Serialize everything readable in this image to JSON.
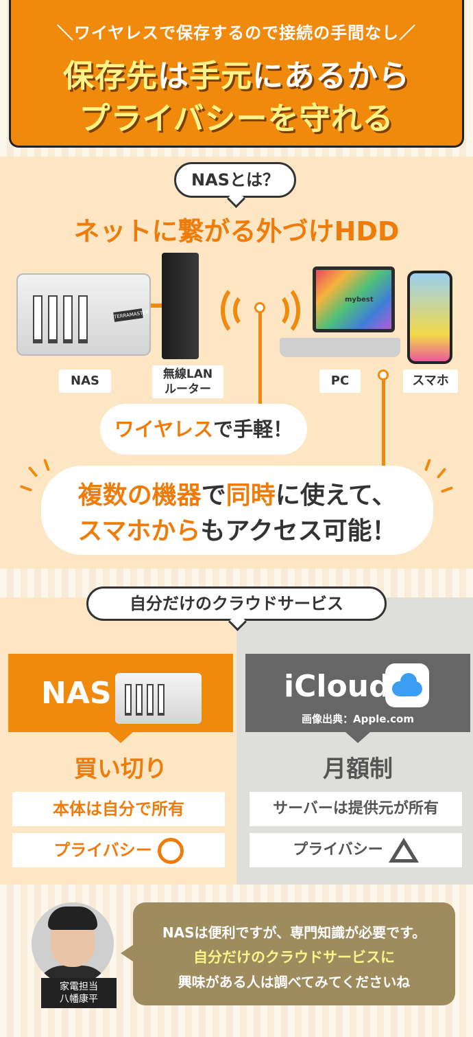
{
  "header": {
    "subtitle": "＼ワイヤレスで保存するので接続の手間なし／",
    "title_line1_a": "保存先",
    "title_line1_b": "は",
    "title_line1_c": "手元",
    "title_line1_d": "にあるから",
    "title_line2": "プライバシーを守れる"
  },
  "nas_intro": {
    "bubble": "NASとは？",
    "title": "ネットに繋がる外づけHDD",
    "devices": {
      "nas": "NAS",
      "router_line1": "無線LAN",
      "router_line2": "ルーター",
      "pc": "PC",
      "phone": "スマホ"
    },
    "nas_plate": "TERRAMASTER",
    "laptop_brand": "mybest",
    "callout1_a": "ワイヤレス",
    "callout1_b": "で手軽！",
    "callout2_line1_a": "複数の機器",
    "callout2_line1_b": "で",
    "callout2_line1_c": "同時",
    "callout2_line1_d": "に使えて、",
    "callout2_line2_a": "スマホから",
    "callout2_line2_b": "も",
    "callout2_line2_c": "アクセス可能！"
  },
  "comparison": {
    "bubble": "自分だけのクラウドサービス",
    "nas": {
      "title": "NAS",
      "price": "買い切り",
      "feature1": "本体は自分で所有",
      "feature2": "プライバシー",
      "feature2_symbol": "circle"
    },
    "icloud": {
      "title": "iCloud",
      "credit": "画像出典：Apple.com",
      "price": "月額制",
      "feature1": "サーバーは提供元が所有",
      "feature2": "プライバシー",
      "feature2_symbol": "triangle"
    }
  },
  "comment": {
    "name_line1": "家電担当",
    "name_line2": "八幡康平",
    "line1": "NASは便利ですが、専門知識が必要です。",
    "line2": "自分だけのクラウドサービスに",
    "line3": "興味がある人は調べてみてくださいね"
  },
  "colors": {
    "accent": "#ef8a0c",
    "icloud_gray": "#666666",
    "comment_bg": "#9e8c5f",
    "highlight_yellow": "#fff38a"
  }
}
